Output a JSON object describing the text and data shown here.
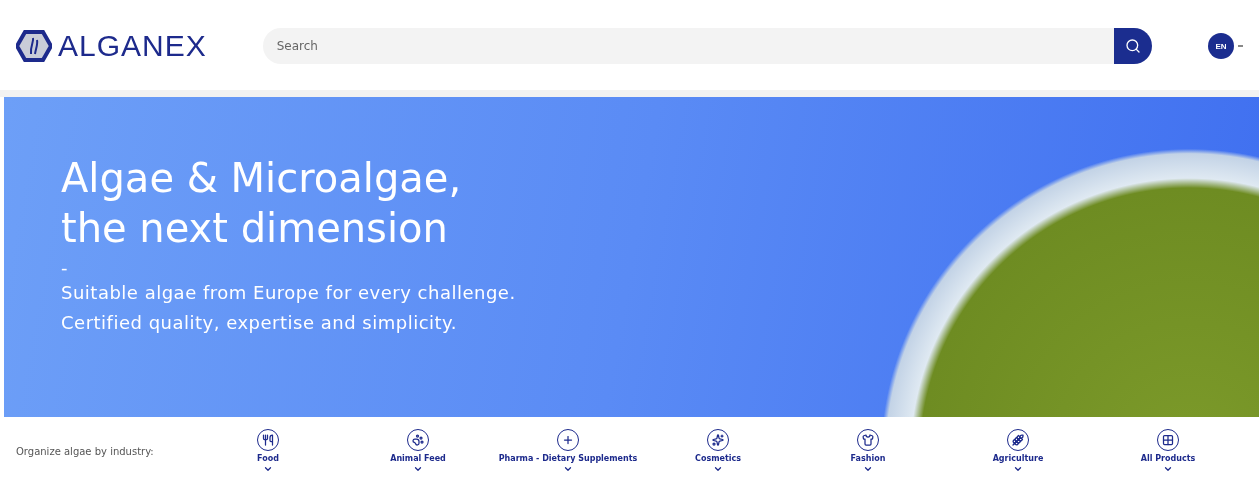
{
  "header": {
    "logo": "ALGANEX",
    "search": {
      "placeholder": "Search"
    },
    "language": "EN"
  },
  "hero": {
    "title_lines": [
      "Algae & Microalgae,",
      "the next dimension"
    ],
    "separator": "-",
    "subtitle_lines": [
      "Suitable algae from Europe for every challenge.",
      "Certified quality, expertise and simplicity."
    ]
  },
  "industries": {
    "label": "Organize algae by industry:",
    "items": [
      {
        "label": "Food"
      },
      {
        "label": "Animal Feed"
      },
      {
        "label": "Pharma - Dietary Supplements"
      },
      {
        "label": "Cosmetics"
      },
      {
        "label": "Fashion"
      },
      {
        "label": "Agriculture"
      },
      {
        "label": "All Products"
      }
    ]
  }
}
